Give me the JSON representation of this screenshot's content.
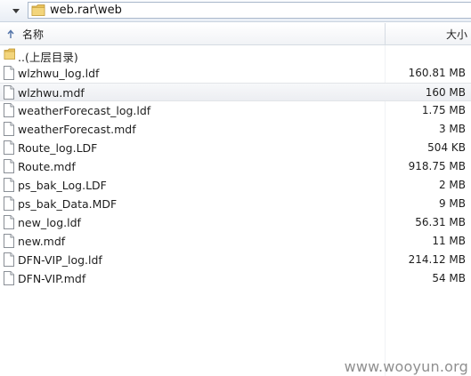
{
  "address_bar": {
    "path": "web.rar\\web"
  },
  "columns": {
    "name": "名称",
    "size": "大小"
  },
  "files": [
    {
      "name": "..(上层目录)",
      "size": "",
      "kind": "folder"
    },
    {
      "name": "wlzhwu_log.ldf",
      "size": "160.81 MB",
      "kind": "file"
    },
    {
      "name": "wlzhwu.mdf",
      "size": "160 MB",
      "kind": "file",
      "selected": true
    },
    {
      "name": "weatherForecast_log.ldf",
      "size": "1.75 MB",
      "kind": "file"
    },
    {
      "name": "weatherForecast.mdf",
      "size": "3 MB",
      "kind": "file"
    },
    {
      "name": "Route_log.LDF",
      "size": "504 KB",
      "kind": "file"
    },
    {
      "name": "Route.mdf",
      "size": "918.75 MB",
      "kind": "file"
    },
    {
      "name": "ps_bak_Log.LDF",
      "size": "2 MB",
      "kind": "file"
    },
    {
      "name": "ps_bak_Data.MDF",
      "size": "9 MB",
      "kind": "file"
    },
    {
      "name": "new_log.ldf",
      "size": "56.31 MB",
      "kind": "file"
    },
    {
      "name": "new.mdf",
      "size": "11 MB",
      "kind": "file"
    },
    {
      "name": "DFN-VIP_log.ldf",
      "size": "214.12 MB",
      "kind": "file"
    },
    {
      "name": "DFN-VIP.mdf",
      "size": "54 MB",
      "kind": "file"
    }
  ],
  "watermark": "www.wooyun.org",
  "colors": {
    "folder": "#e8c15a",
    "selection": "#eceef2",
    "header_border": "#d5dbe3"
  }
}
